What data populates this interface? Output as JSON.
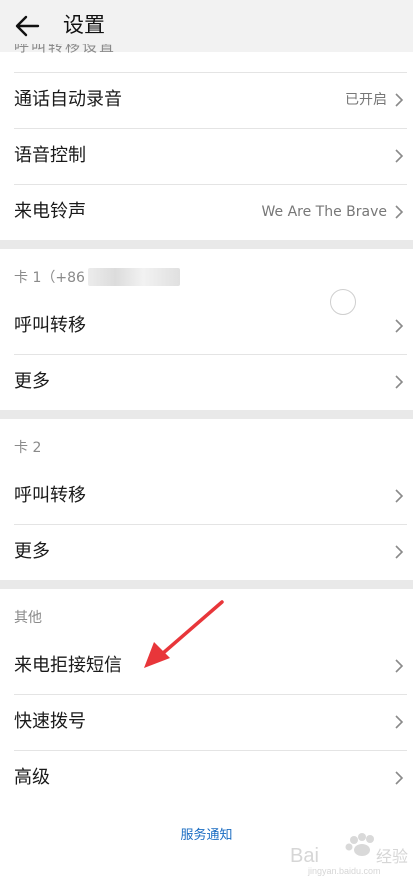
{
  "header": {
    "title": "设置",
    "back_icon": "arrow-left-icon"
  },
  "top_cutoff_text": "呼叫转移设置",
  "rows": [
    {
      "label": "通话自动录音",
      "value": "已开启"
    },
    {
      "label": "语音控制",
      "value": ""
    },
    {
      "label": "来电铃声",
      "value": "We Are The Brave"
    }
  ],
  "sim1": {
    "title": "卡 1（+86",
    "items": [
      {
        "label": "呼叫转移"
      },
      {
        "label": "更多"
      }
    ]
  },
  "sim2": {
    "title": "卡 2",
    "items": [
      {
        "label": "呼叫转移"
      },
      {
        "label": "更多"
      }
    ]
  },
  "other": {
    "title": "其他",
    "items": [
      {
        "label": "来电拒接短信"
      },
      {
        "label": "快速拨号"
      },
      {
        "label": "高级"
      }
    ]
  },
  "footer": {
    "link": "服务通知"
  },
  "watermark": "Bai经验",
  "colors": {
    "accent_link": "#1a6cc2",
    "arrow_annotation": "#e8363a",
    "section_gap": "#e9e9e9"
  }
}
